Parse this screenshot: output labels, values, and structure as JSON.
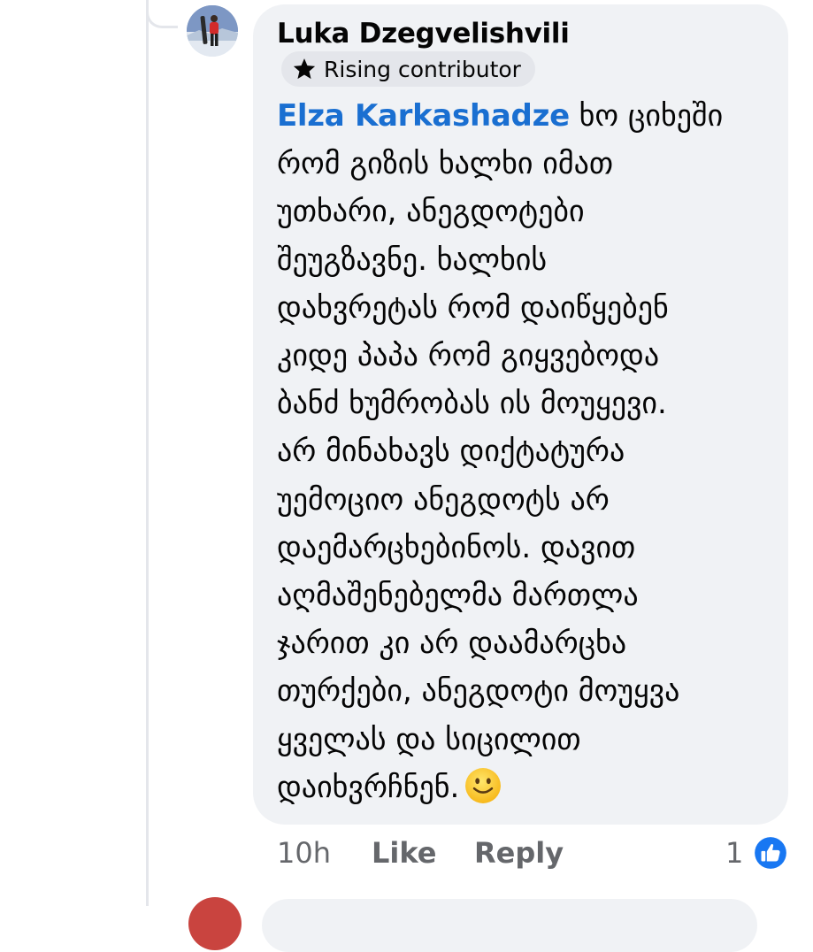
{
  "comment": {
    "author": "Luka Dzegvelishvili",
    "badge": "Rising contributor",
    "mention": "Elza Karkashadze",
    "lines": [
      " ხო ციხეში",
      "რომ გიზის ხალხი იმათ",
      "უთხარი, ანეგდოტები",
      "შეუგზავნე. ხალხის",
      "დახვრეტას რომ დაიწყებენ",
      "კიდე პაპა რომ გიყვებოდა",
      "ბანძ ხუმრობას ის მოუყევი.",
      "არ მინახავს დიქტატურა",
      "უემოციო ანეგდოტს არ",
      "დაემარცხებინოს. დავით",
      "აღმაშენებელმა მართლა",
      "ჯარით კი არ დაამარცხა",
      "თურქები, ანეგდოტი მოუყვა",
      "ყველას და სიცილით",
      "დაიხვრჩნენ."
    ],
    "emoji": "slightly-smiling-face"
  },
  "actions": {
    "time": "10h",
    "like": "Like",
    "reply": "Reply",
    "reaction_count": "1",
    "reaction_icon": "like-thumb-icon"
  },
  "colors": {
    "bubble": "#f0f2f5",
    "mention": "#1a6fd1",
    "meta": "#65676b",
    "like_blue": "#1877f2"
  }
}
